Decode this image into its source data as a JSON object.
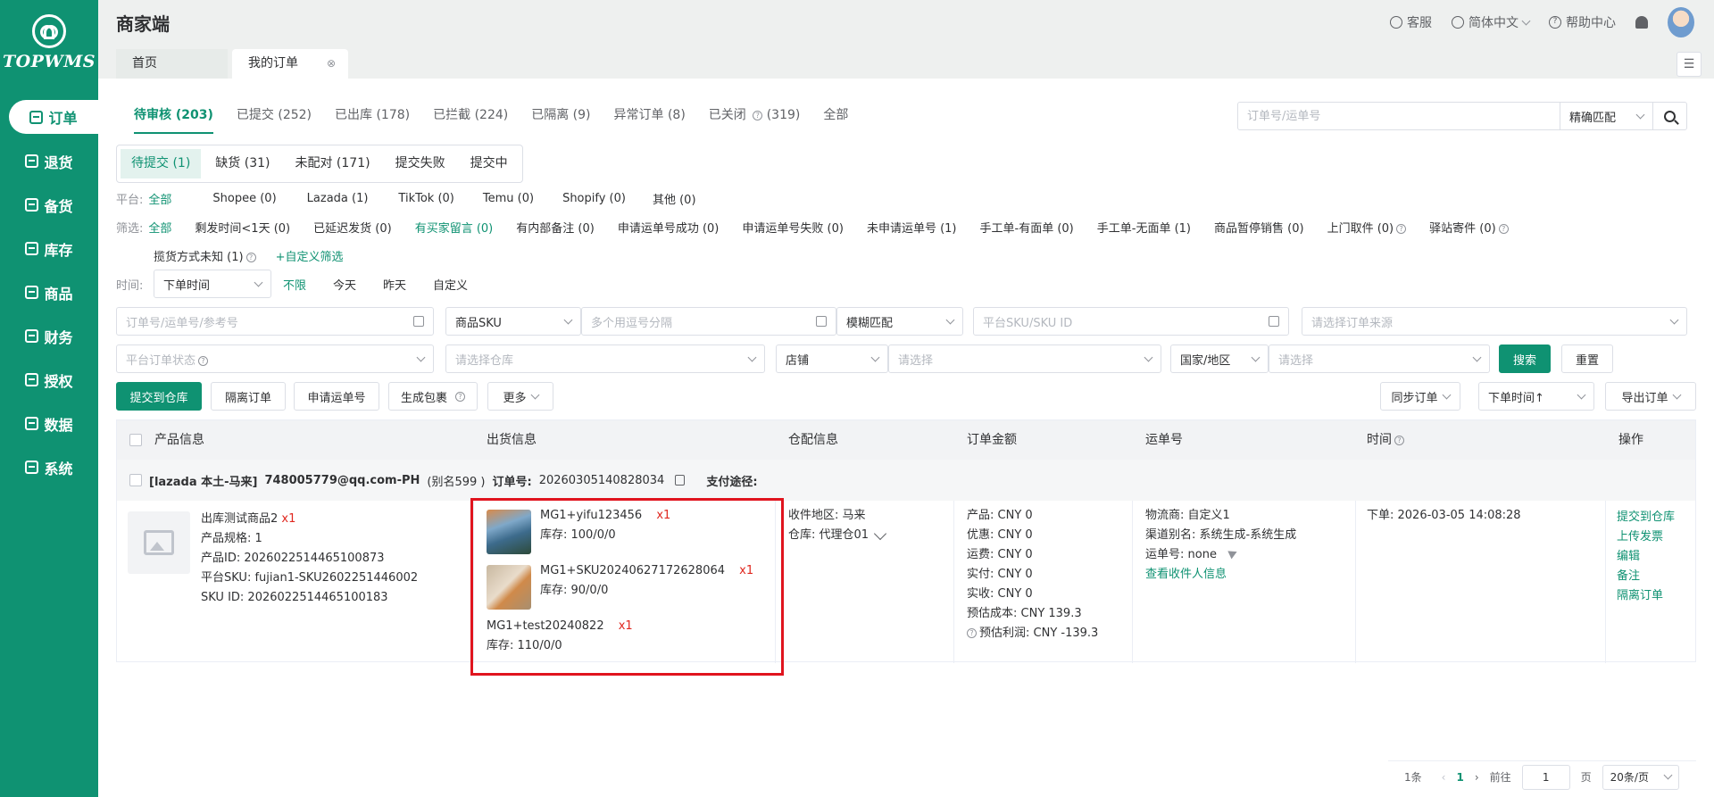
{
  "sidebar": {
    "logo": "TOPWMS",
    "items": [
      {
        "label": "订单",
        "icon": "order-icon"
      },
      {
        "label": "退货",
        "icon": "return-icon"
      },
      {
        "label": "备货",
        "icon": "stock-prep-icon"
      },
      {
        "label": "库存",
        "icon": "inventory-icon"
      },
      {
        "label": "商品",
        "icon": "goods-icon"
      },
      {
        "label": "财务",
        "icon": "finance-icon"
      },
      {
        "label": "授权",
        "icon": "auth-icon"
      },
      {
        "label": "数据",
        "icon": "data-icon"
      },
      {
        "label": "系统",
        "icon": "system-icon"
      }
    ]
  },
  "header": {
    "title": "商家端",
    "service": "客服",
    "language": "简体中文",
    "help": "帮助中心"
  },
  "page_tabs": {
    "home": "首页",
    "current": "我的订单"
  },
  "status_tabs": [
    "待审核 (203)",
    "已提交 (252)",
    "已出库 (178)",
    "已拦截 (224)",
    "已隔离 (9)",
    "异常订单 (8)",
    "已关闭",
    "(319)",
    "全部"
  ],
  "top_search": {
    "placeholder": "订单号/运单号",
    "match": "精确匹配"
  },
  "sub_tabs": [
    "待提交 (1)",
    "缺货 (31)",
    "未配对 (171)",
    "提交失败",
    "提交中"
  ],
  "platform": {
    "label": "平台:",
    "items": [
      "全部",
      "Shopee (0)",
      "Lazada (1)",
      "TikTok (0)",
      "Temu (0)",
      "Shopify (0)",
      "其他 (0)"
    ]
  },
  "filter": {
    "label": "筛选:",
    "items": [
      "全部",
      "剩发时间<1天 (0)",
      "已延迟发货 (0)",
      "有买家留言 (0)",
      "有内部备注 (0)",
      "申请运单号成功 (0)",
      "申请运单号失败 (0)",
      "未申请运单号 (1)",
      "手工单-有面单 (0)",
      "手工单-无面单 (1)",
      "商品暂停销售 (0)",
      "上门取件 (0)",
      "驿站寄件 (0)"
    ],
    "row2_item": "揽货方式未知 (1)",
    "custom": "+自定义筛选"
  },
  "time": {
    "label": "时间:",
    "select": "下单时间",
    "items": [
      "不限",
      "今天",
      "昨天",
      "自定义"
    ]
  },
  "search_form": {
    "order_ph": "订单号/运单号/参考号",
    "sku_select": "商品SKU",
    "sku_ph": "多个用逗号分隔",
    "fuzzy": "模糊匹配",
    "platform_sku_ph": "平台SKU/SKU ID",
    "source_ph": "请选择订单来源",
    "platform_status_ph": "平台订单状态",
    "warehouse_ph": "请选择仓库",
    "store_select": "店铺",
    "store_ph": "请选择",
    "country_select": "国家/地区",
    "country_ph": "请选择",
    "search_btn": "搜索",
    "reset_btn": "重置"
  },
  "actions": {
    "submit": "提交到仓库",
    "isolate": "隔离订单",
    "apply_tracking": "申请运单号",
    "gen_package": "生成包裹",
    "more": "更多",
    "sync": "同步订单",
    "sort": "下单时间↑",
    "export": "导出订单"
  },
  "table": {
    "headers": {
      "product": "产品信息",
      "shipping": "出货信息",
      "warehouse": "仓配信息",
      "amount": "订单金额",
      "tracking": "运单号",
      "time": "时间",
      "ops": "操作"
    },
    "group": {
      "store": "[lazada 本土-马来]",
      "buyer": "748005779@qq.com-PH",
      "alias": "(别名599 )",
      "order_label": "订单号:",
      "order_no": "20260305140828034",
      "pay_label": "支付途径:"
    },
    "product": {
      "name": "出库测试商品2",
      "qty": "x1",
      "spec": "产品规格:  1",
      "product_id": "产品ID:  2026022514465100873",
      "platform_sku": "平台SKU:  fujian1-SKU2602251446002",
      "sku_id": "SKU ID:  2026022514465100183"
    },
    "shipments": [
      {
        "sku": "MG1+yifu123456",
        "qty": "x1",
        "stock": "库存:  100/0/0"
      },
      {
        "sku": "MG1+SKU20240627172628064",
        "qty": "x1",
        "stock": "库存:  90/0/0"
      },
      {
        "sku": "MG1+test20240822",
        "qty": "x1",
        "stock": "库存:  110/0/0"
      }
    ],
    "warehouse": {
      "region": "收件地区:  马来",
      "warehouse": "仓库:  代理仓01"
    },
    "amount": {
      "product": "产品:  CNY 0",
      "discount": "优惠:  CNY 0",
      "freight": "运费:  CNY 0",
      "paid": "实付:  CNY 0",
      "received": "实收:  CNY 0",
      "est_cost": "预估成本:  CNY 139.3",
      "est_profit": "预估利润:  CNY -139.3"
    },
    "tracking": {
      "carrier": "物流商:  自定义1",
      "channel": "渠道别名:  系统生成-系统生成",
      "number": "运单号:  none",
      "view_receiver": "查看收件人信息"
    },
    "time": {
      "ordered": "下单:  2026-03-05 14:08:28"
    },
    "ops": [
      "提交到仓库",
      "上传发票",
      "编辑",
      "备注",
      "隔离订单"
    ]
  },
  "pagination": {
    "total": "1条",
    "page": "1",
    "goto": "前往",
    "input": "1",
    "unit": "页",
    "size": "20条/页"
  },
  "colors": {
    "primary": "#0f9272",
    "danger": "#e0271f"
  }
}
